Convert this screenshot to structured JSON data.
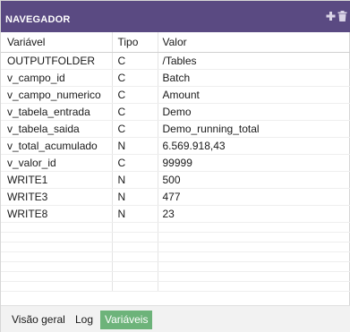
{
  "panel": {
    "title": "NAVEGADOR"
  },
  "table": {
    "headers": [
      "Variável",
      "Tipo",
      "Valor"
    ],
    "rows": [
      [
        "OUTPUTFOLDER",
        "C",
        "/Tables"
      ],
      [
        "v_campo_id",
        "C",
        "Batch"
      ],
      [
        "v_campo_numerico",
        "C",
        "Amount"
      ],
      [
        "v_tabela_entrada",
        "C",
        "Demo"
      ],
      [
        "v_tabela_saida",
        "C",
        "Demo_running_total"
      ],
      [
        "v_total_acumulado",
        "N",
        "6.569.918,43"
      ],
      [
        "v_valor_id",
        "C",
        "99999"
      ],
      [
        "WRITE1",
        "N",
        "500"
      ],
      [
        "WRITE3",
        "N",
        "477"
      ],
      [
        "WRITE8",
        "N",
        "23"
      ]
    ]
  },
  "tabs": [
    {
      "label": "Visão geral",
      "active": false
    },
    {
      "label": "Log",
      "active": false
    },
    {
      "label": "Variáveis",
      "active": true
    }
  ],
  "colors": {
    "header": "#5a4a82",
    "active_tab": "#6db37a"
  },
  "icons": [
    "add-icon",
    "trash-icon"
  ]
}
